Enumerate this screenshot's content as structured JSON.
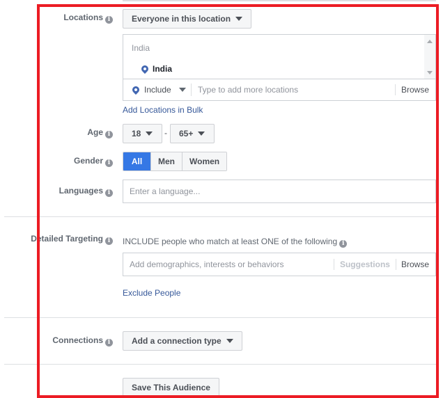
{
  "locations": {
    "label": "Locations",
    "audience_type_dropdown": "Everyone in this location",
    "list_header": "India",
    "selected_locations": [
      "India"
    ],
    "include_dropdown": "Include",
    "search_placeholder": "Type to add more locations",
    "browse_label": "Browse",
    "bulk_link": "Add Locations in Bulk"
  },
  "age": {
    "label": "Age",
    "min": "18",
    "separator": "-",
    "max": "65+"
  },
  "gender": {
    "label": "Gender",
    "options": [
      "All",
      "Men",
      "Women"
    ],
    "selected": "All"
  },
  "languages": {
    "label": "Languages",
    "placeholder": "Enter a language..."
  },
  "detailed_targeting": {
    "label": "Detailed Targeting",
    "include_text": "INCLUDE people who match at least ONE of the following",
    "search_placeholder": "Add demographics, interests or behaviors",
    "suggestions_label": "Suggestions",
    "browse_label": "Browse",
    "exclude_link": "Exclude People"
  },
  "connections": {
    "label": "Connections",
    "dropdown": "Add a connection type"
  },
  "save_audience_button": "Save This Audience",
  "info_glyph": "i",
  "colors": {
    "highlight_frame": "#ec1c24",
    "selected_segment": "#3578e5",
    "link": "#365899",
    "pin": "#4267b2"
  }
}
